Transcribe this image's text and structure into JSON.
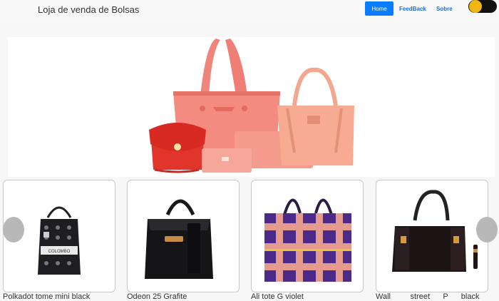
{
  "header": {
    "brand": "Loja de venda de Bolsas",
    "nav": {
      "home": "Home",
      "feedback": "FeedBack",
      "about": "Sobre"
    }
  },
  "theme_toggle": {
    "knob_color": "#f2b614",
    "track_color": "#111111"
  },
  "hero": {
    "image": "bags-collection-photo"
  },
  "products": [
    {
      "name": "Polkadot tome mini black",
      "bag_label": "COLOMBO"
    },
    {
      "name": "Odeon 25 Grafite"
    },
    {
      "name": "Ali tote G violet"
    },
    {
      "name": "Wall         street      P      black"
    }
  ],
  "colors": {
    "accent": "#0a7cff",
    "link": "#1a6ee8"
  }
}
